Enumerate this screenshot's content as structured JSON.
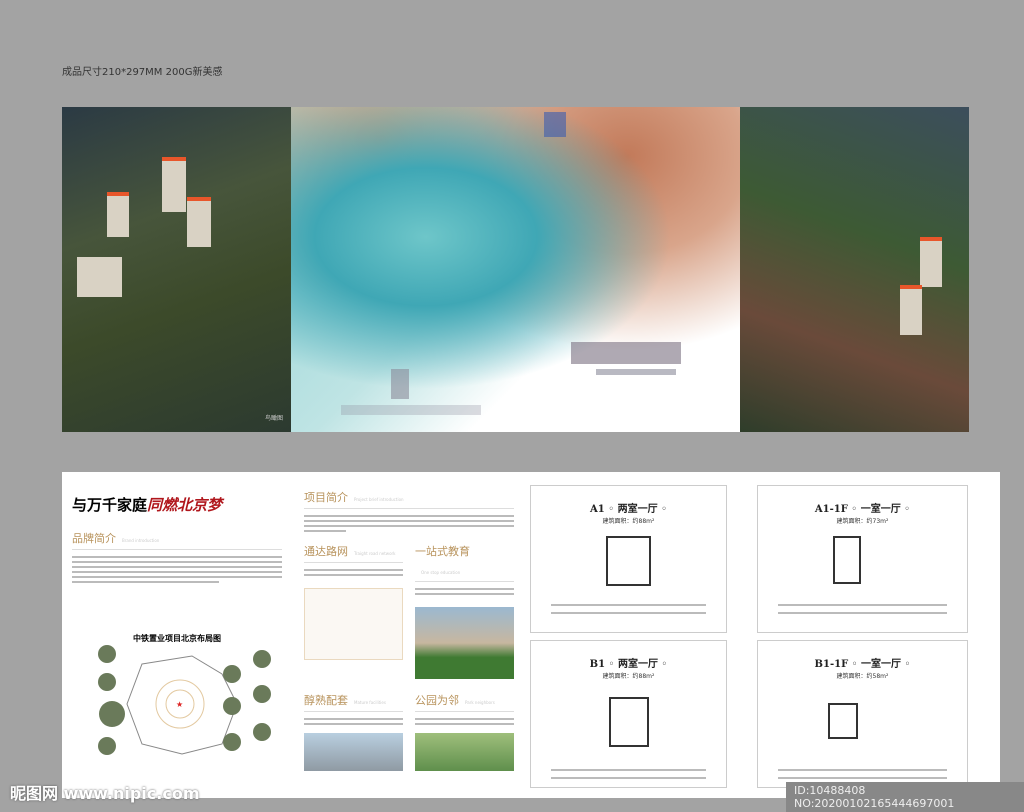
{
  "spec_label": "成品尺寸210*297MM  200G新美感",
  "cover": {
    "aerial_label": "鸟瞰图"
  },
  "brochure": {
    "headline_black": "与万千家庭",
    "headline_red": "同燃北京梦",
    "brand_intro": {
      "title": "品牌简介",
      "sub": "Brand introduction"
    },
    "map_title": "中铁置业项目北京布局图",
    "project_intro": {
      "title": "项目简介",
      "sub": "Project brief introduction"
    },
    "traffic": {
      "title": "通达路网",
      "sub": "Traight road network"
    },
    "education": {
      "title": "一站式教育",
      "sub": "One stop education"
    },
    "amenities": {
      "title": "醇熟配套",
      "sub": "Mature facilities"
    },
    "park": {
      "title": "公园为邻",
      "sub": "Park neighbors"
    },
    "units": [
      {
        "code": "A1",
        "type": "两室一厅",
        "area": "建筑面积：约88m²"
      },
      {
        "code": "A1-1F",
        "type": "一室一厅",
        "area": "建筑面积：约73m²"
      },
      {
        "code": "B1",
        "type": "两室一厅",
        "area": "建筑面积：约88m²"
      },
      {
        "code": "B1-1F",
        "type": "一室一厅",
        "area": "建筑面积：约58m²"
      }
    ]
  },
  "watermark": "昵图网 www.nipic.com",
  "id_label": "ID:10488408 NO:20200102165444697001"
}
